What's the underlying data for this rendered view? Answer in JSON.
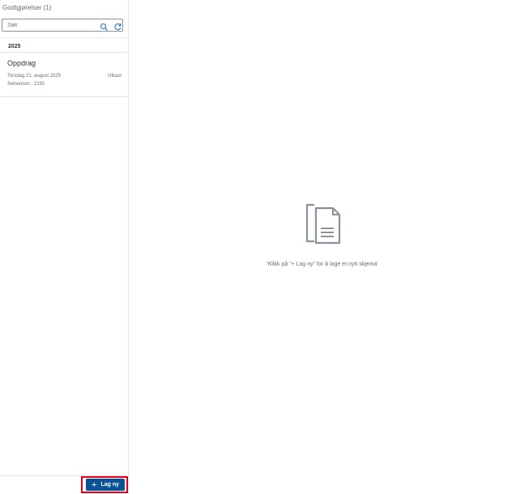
{
  "master": {
    "title": "Godtgjørelser (1)",
    "search": {
      "placeholder": "Søk",
      "value": "",
      "search_icon": "search-icon",
      "refresh_icon": "refresh-icon"
    },
    "groups": [
      {
        "year": "2025",
        "items": [
          {
            "title": "Oppdrag",
            "date": "Torsdag 21. august 2025",
            "sequence": "Sekvensnr.: 2191",
            "status": "Utkast"
          }
        ]
      }
    ],
    "footer": {
      "create_label": "Lag ny",
      "create_icon": "plus-icon",
      "highlight_color": "#e3001b"
    }
  },
  "detail": {
    "empty_icon": "document-icon",
    "empty_text": "'Klikk på \"+ Lag ny\" for å lage et nytt skjema'"
  },
  "colors": {
    "accent": "#0b5394",
    "border": "#e5e5e5",
    "muted_text": "#6a6d70"
  }
}
